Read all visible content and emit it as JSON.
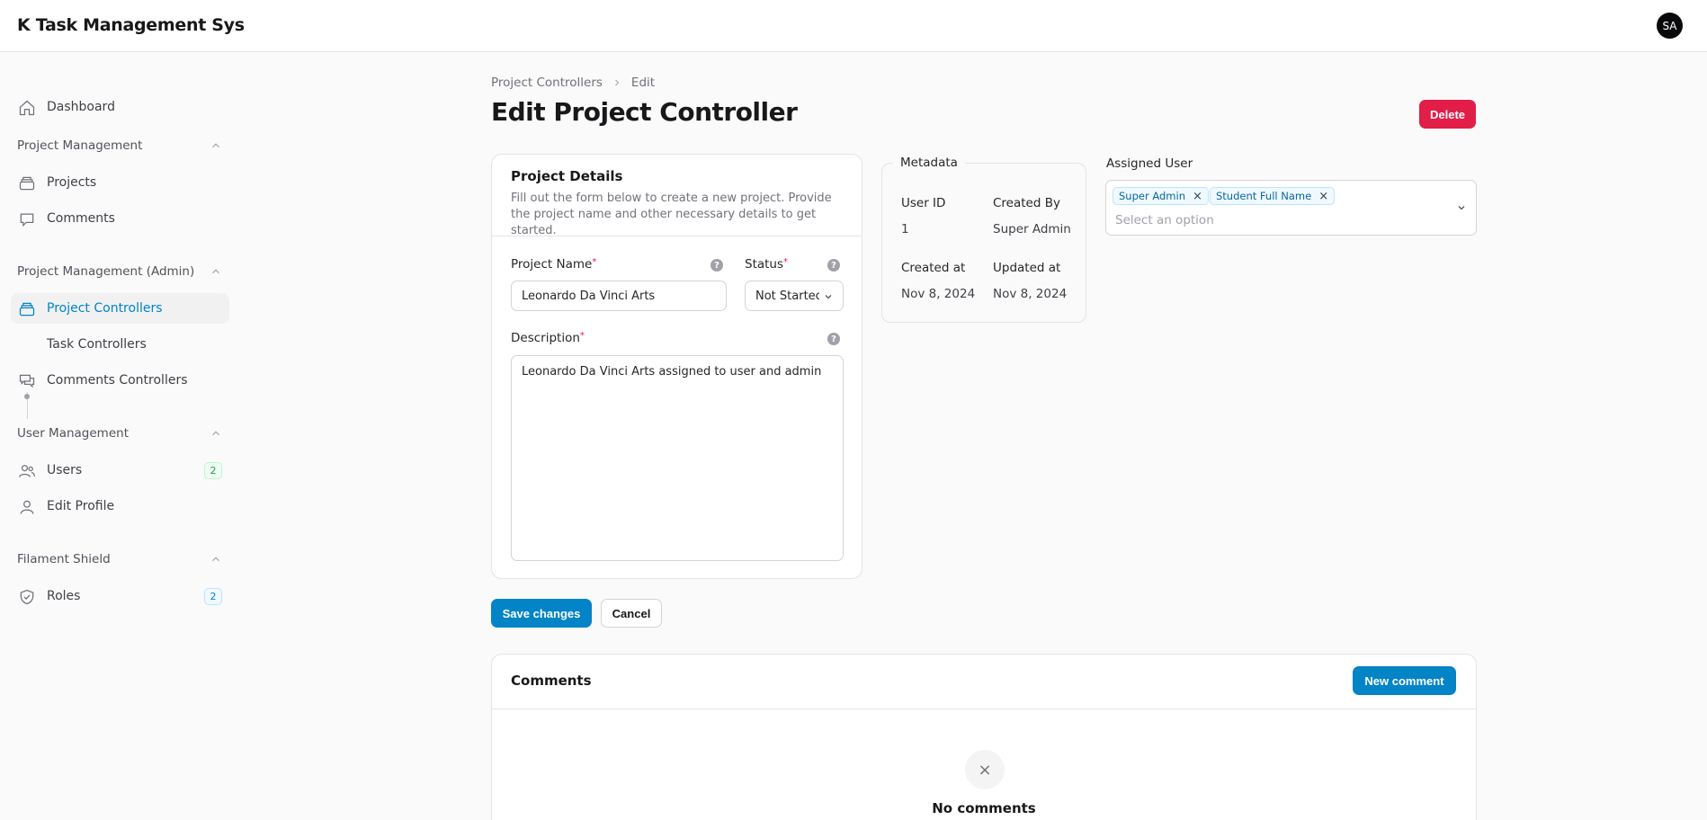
{
  "app": {
    "title": "K Task Management Sys",
    "avatar_initials": "SA"
  },
  "sidebar": {
    "dashboard": "Dashboard",
    "groups": [
      {
        "title": "Project Management",
        "items": [
          "Projects",
          "Comments"
        ]
      },
      {
        "title": "Project Management (Admin)",
        "items": [
          "Project Controllers",
          "Task Controllers",
          "Comments Controllers"
        ]
      },
      {
        "title": "User Management",
        "items": [
          "Users",
          "Edit Profile"
        ]
      },
      {
        "title": "Filament Shield",
        "items": [
          "Roles"
        ]
      }
    ],
    "badges": {
      "users": "2",
      "roles": "2"
    },
    "active_item": "Project Controllers"
  },
  "breadcrumb": {
    "parent": "Project Controllers",
    "current": "Edit"
  },
  "page": {
    "title": "Edit Project Controller",
    "delete_label": "Delete"
  },
  "details": {
    "heading": "Project Details",
    "description": "Fill out the form below to create a new project. Provide the project name and other necessary details to get started.",
    "name_label": "Project Name",
    "name_value": "Leonardo Da Vinci Arts",
    "status_label": "Status",
    "status_value": "Not Startec",
    "description_label": "Description",
    "description_value": "Leonardo Da Vinci Arts assigned to user and admin",
    "required_mark": "*",
    "help_mark": "?"
  },
  "metadata": {
    "legend": "Metadata",
    "user_id_label": "User ID",
    "user_id_value": "1",
    "created_by_label": "Created By",
    "created_by_value": "Super Admin",
    "created_at_label": "Created at",
    "created_at_value": "Nov 8, 2024",
    "updated_at_label": "Updated at",
    "updated_at_value": "Nov 8, 2024"
  },
  "assigned": {
    "label": "Assigned User",
    "chips": [
      "Super Admin",
      "Student Full Name"
    ],
    "placeholder": "Select an option",
    "remove_glyph": "×"
  },
  "actions": {
    "save_label": "Save changes",
    "cancel_label": "Cancel"
  },
  "comments": {
    "heading": "Comments",
    "new_label": "New comment",
    "empty_title": "No comments",
    "empty_glyph": "×"
  },
  "colors": {
    "primary": "#0284c7",
    "danger": "#e11d48"
  }
}
